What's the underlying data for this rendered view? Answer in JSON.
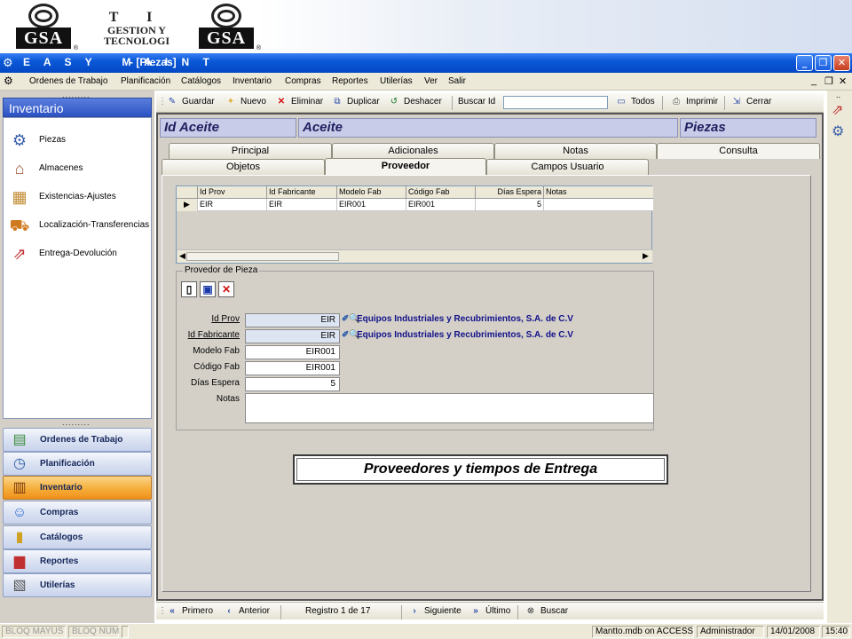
{
  "banner": {
    "logo_left": "GSA",
    "logo_right": "GSA",
    "ti_title": "T I",
    "ti_sub1": "GESTION Y",
    "ti_sub2": "TECNOLOGI"
  },
  "window": {
    "app_name": "E A S Y   M A I N T",
    "doc_title": "- [Piezas]"
  },
  "menu": [
    "Ordenes de Trabajo",
    "Planificación",
    "Catálogos",
    "Inventario",
    "Compras",
    "Reportes",
    "Utilerías",
    "Ver",
    "Salir"
  ],
  "nav": {
    "header": "Inventario",
    "items": [
      "Piezas",
      "Almacenes",
      "Existencias-Ajustes",
      "Localización-Transferencias",
      "Entrega-Devolución"
    ],
    "modules": [
      "Ordenes de Trabajo",
      "Planificación",
      "Inventario",
      "Compras",
      "Catálogos",
      "Reportes",
      "Utilerías"
    ],
    "active_module": "Inventario"
  },
  "toolbar": {
    "guardar": "Guardar",
    "nuevo": "Nuevo",
    "eliminar": "Eliminar",
    "duplicar": "Duplicar",
    "deshacer": "Deshacer",
    "buscar_id": "Buscar Id",
    "buscar_value": "",
    "todos": "Todos",
    "imprimir": "Imprimir",
    "cerrar": "Cerrar"
  },
  "record": {
    "id_label": "Id  Aceite",
    "name": "Aceite",
    "category": "Piezas"
  },
  "tabs_row1": [
    "Principal",
    "Adicionales",
    "Notas",
    "Consulta"
  ],
  "tabs_row2": [
    "Objetos",
    "Proveedor",
    "Campos Usuario"
  ],
  "selected_tab": "Proveedor",
  "grid": {
    "columns": [
      "Id Prov",
      "Id Fabricante",
      "Modelo Fab",
      "Código Fab",
      "Días Espera",
      "Notas"
    ],
    "rows": [
      [
        "EIR",
        "EIR",
        "EIR001",
        "EIR001",
        "5",
        ""
      ]
    ]
  },
  "proveedor": {
    "legend": "Provedor de Pieza",
    "labels": {
      "id_prov": "Id Prov",
      "id_fab": "Id Fabricante",
      "modelo": "Modelo Fab",
      "codigo": "Código Fab",
      "dias": "Días Espera",
      "notas": "Notas"
    },
    "values": {
      "id_prov": "EIR",
      "id_fab": "EIR",
      "modelo": "EIR001",
      "codigo": "EIR001",
      "dias": "5",
      "notas": ""
    },
    "prov_name": "Equipos Industriales y Recubrimientos, S.A. de C.V",
    "fab_name": "Equipos Industriales y Recubrimientos, S.A. de C.V"
  },
  "caption": "Proveedores y tiempos de Entrega",
  "navbar": {
    "primero": "Primero",
    "anterior": "Anterior",
    "registro": "Registro 1 de 17",
    "siguiente": "Siguiente",
    "ultimo": "Último",
    "buscar": "Buscar"
  },
  "status": {
    "mayus": "BLOQ MAYUS",
    "num": "BLOQ NUM",
    "db": "Mantto.mdb on ACCESS",
    "user": "Administrador",
    "date": "14/01/2008",
    "time": "15:40"
  },
  "colors": {
    "titlebar": "#0a59d8",
    "active_module": "#f5ae3a",
    "supplier_link": "#11118a"
  }
}
